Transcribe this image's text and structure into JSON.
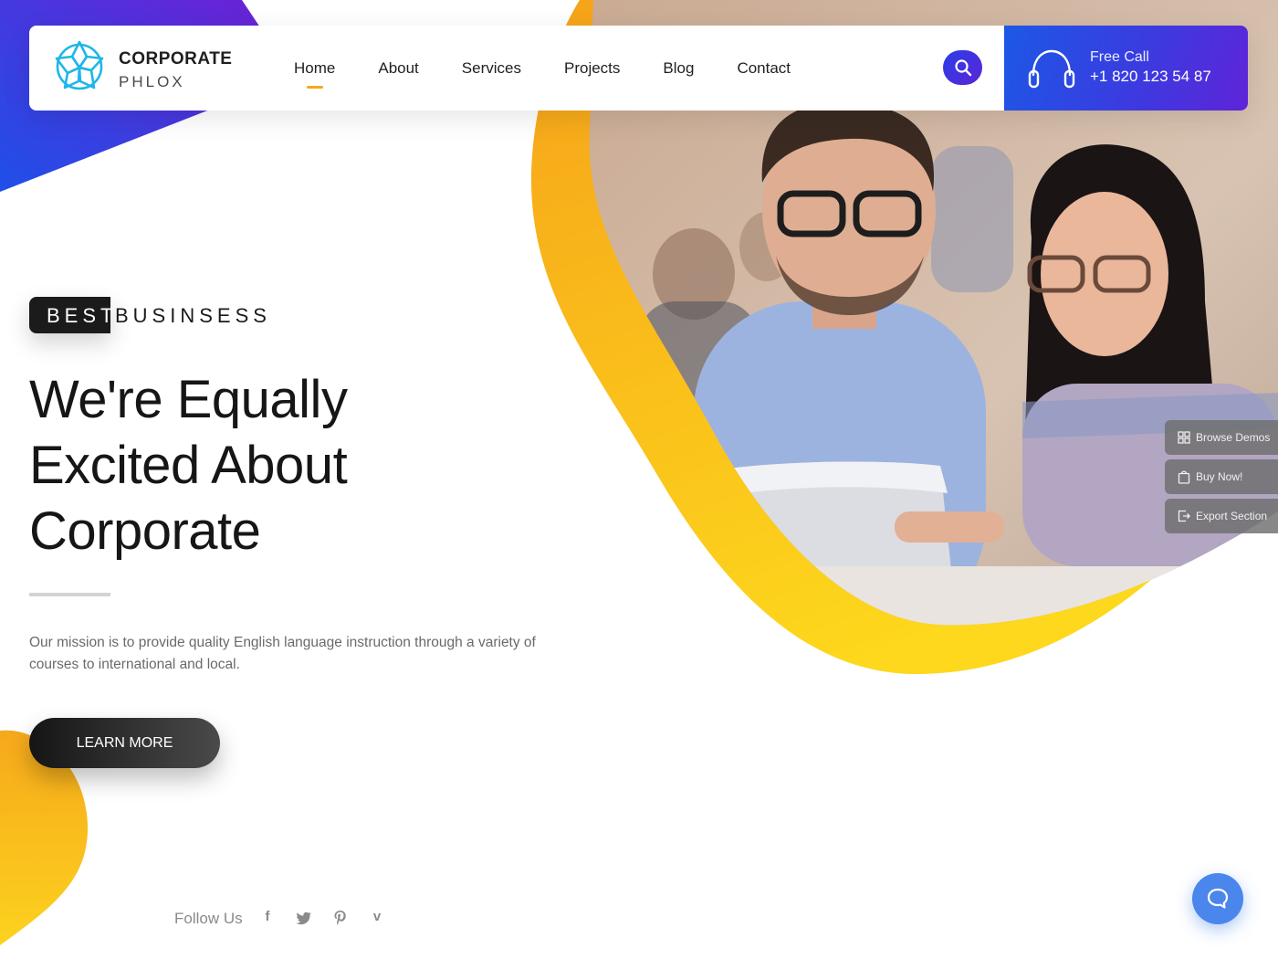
{
  "brand": {
    "line1": "CORPORATE",
    "line2": "PHLOX"
  },
  "nav": {
    "items": [
      {
        "label": "Home",
        "active": true
      },
      {
        "label": "About"
      },
      {
        "label": "Services"
      },
      {
        "label": "Projects"
      },
      {
        "label": "Blog"
      },
      {
        "label": "Contact"
      }
    ]
  },
  "call": {
    "label": "Free Call",
    "number": "+1 820 123 54 87"
  },
  "hero": {
    "tag_highlight": "BEST",
    "tag_rest": "BUSINSESS",
    "title_lines": [
      "We're Equally",
      "Excited About",
      "Corporate"
    ],
    "description": "Our mission is to provide quality English language instruction through a variety of courses to international and local.",
    "cta_label": "LEARN MORE"
  },
  "social": {
    "label": "Follow Us",
    "icons": [
      "facebook-icon",
      "twitter-icon",
      "pinterest-icon",
      "vimeo-icon"
    ]
  },
  "side_tools": {
    "browse": "Browse Demos",
    "buy": "Buy Now!",
    "export": "Export Section"
  },
  "colors": {
    "accent_blue": "#1c58e6",
    "accent_purple": "#5f24d8",
    "accent_orange": "#f6a91b",
    "accent_yellow": "#fcd21e",
    "chat_blue": "#4a86ec"
  }
}
